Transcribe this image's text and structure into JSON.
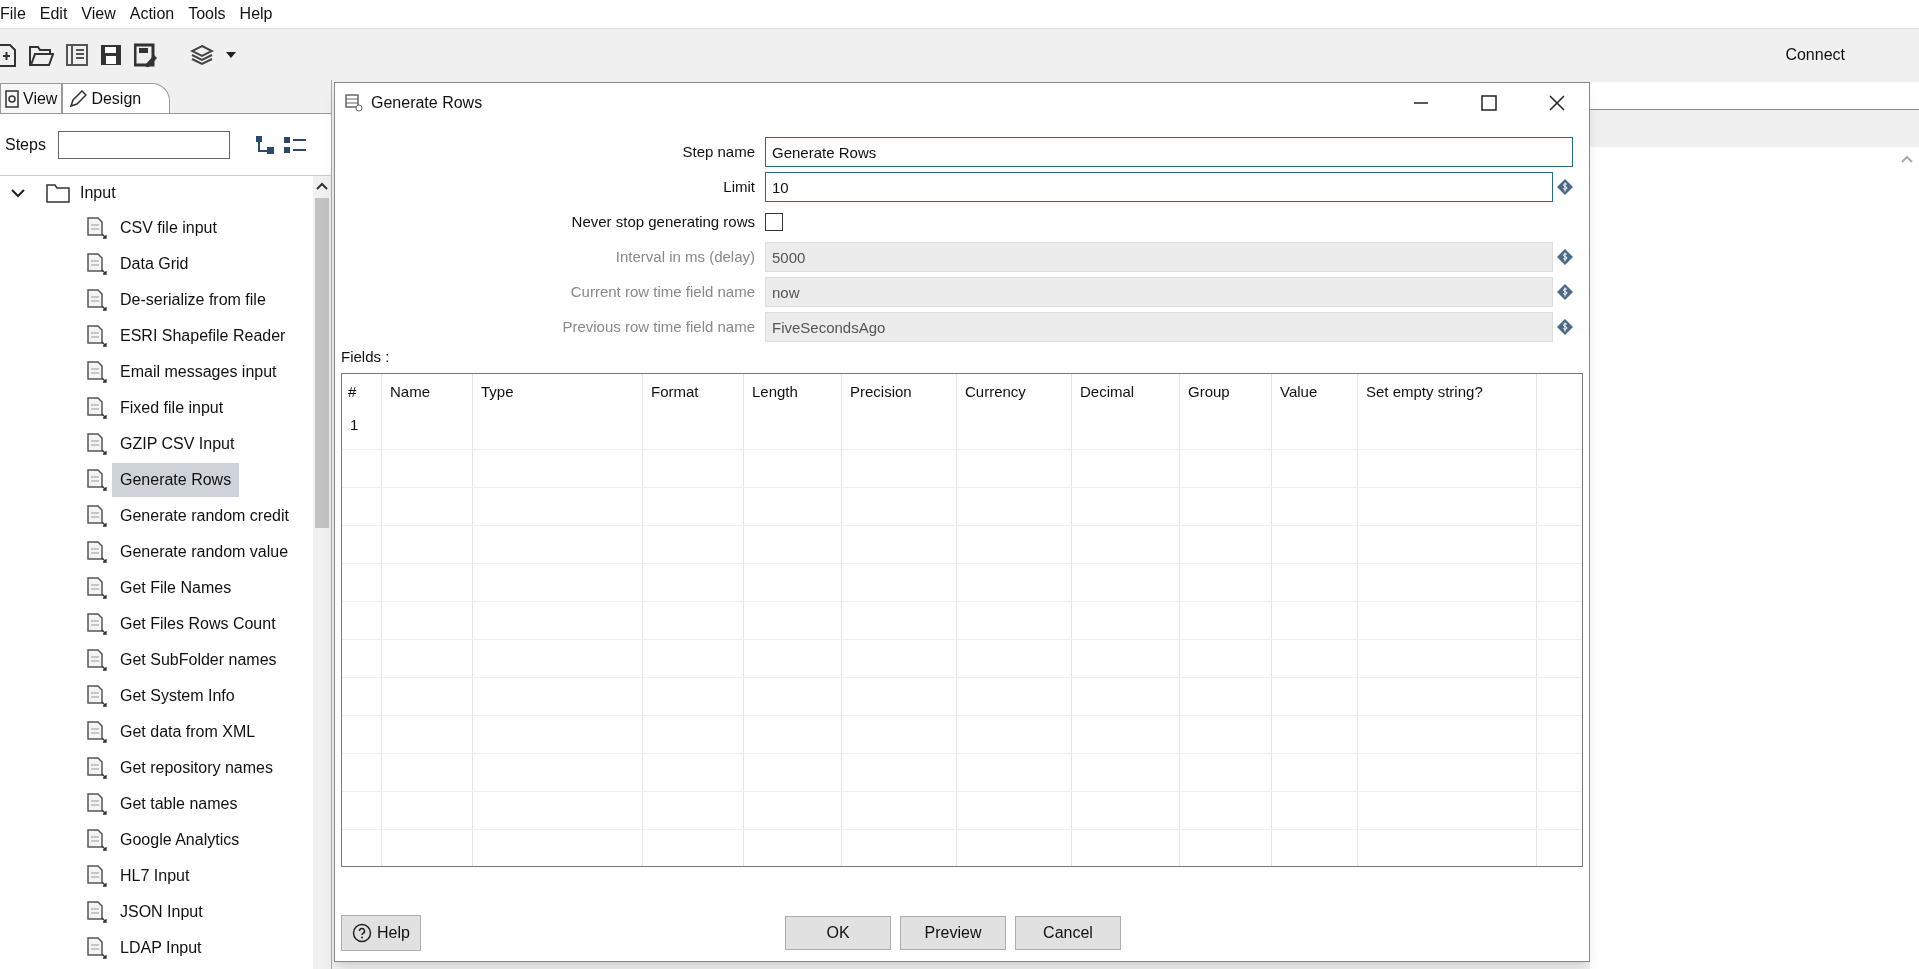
{
  "menu": [
    "File",
    "Edit",
    "View",
    "Action",
    "Tools",
    "Help"
  ],
  "toolbar": {
    "connect": "Connect"
  },
  "left_panel": {
    "tabs": [
      {
        "label": "View",
        "selected": false
      },
      {
        "label": "Design",
        "selected": true
      }
    ],
    "steps_label": "Steps",
    "tree": [
      {
        "label": "Input",
        "expanded": true,
        "children": [
          {
            "label": "CSV file input",
            "selected": false
          },
          {
            "label": "Data Grid",
            "selected": false
          },
          {
            "label": "De-serialize from file",
            "selected": false
          },
          {
            "label": "ESRI Shapefile Reader",
            "selected": false
          },
          {
            "label": "Email messages input",
            "selected": false
          },
          {
            "label": "Fixed file input",
            "selected": false
          },
          {
            "label": "GZIP CSV Input",
            "selected": false
          },
          {
            "label": "Generate Rows",
            "selected": true
          },
          {
            "label": "Generate random credit",
            "selected": false
          },
          {
            "label": "Generate random value",
            "selected": false
          },
          {
            "label": "Get File Names",
            "selected": false
          },
          {
            "label": "Get Files Rows Count",
            "selected": false
          },
          {
            "label": "Get SubFolder names",
            "selected": false
          },
          {
            "label": "Get System Info",
            "selected": false
          },
          {
            "label": "Get data from XML",
            "selected": false
          },
          {
            "label": "Get repository names",
            "selected": false
          },
          {
            "label": "Get table names",
            "selected": false
          },
          {
            "label": "Google Analytics",
            "selected": false
          },
          {
            "label": "HL7 Input",
            "selected": false
          },
          {
            "label": "JSON Input",
            "selected": false
          },
          {
            "label": "LDAP Input",
            "selected": false
          }
        ]
      }
    ]
  },
  "dialog": {
    "title": "Generate Rows",
    "form": [
      {
        "kind": "text",
        "label": "Step name",
        "value": "Generate Rows",
        "disabled": false,
        "variable": false
      },
      {
        "kind": "text",
        "label": "Limit",
        "value": "10",
        "disabled": false,
        "variable": true
      },
      {
        "kind": "checkbox",
        "label": "Never stop generating rows",
        "checked": false
      },
      {
        "kind": "text",
        "label": "Interval in ms (delay)",
        "value": "5000",
        "disabled": true,
        "variable": true
      },
      {
        "kind": "text",
        "label": "Current row time field name",
        "value": "now",
        "disabled": true,
        "variable": true
      },
      {
        "kind": "text",
        "label": "Previous row time field name",
        "value": "FiveSecondsAgo",
        "disabled": true,
        "variable": true
      }
    ],
    "fields_label": "Fields :",
    "table": {
      "columns": [
        "#",
        "Name",
        "Type",
        "Format",
        "Length",
        "Precision",
        "Currency",
        "Decimal",
        "Group",
        "Value",
        "Set empty string?"
      ],
      "rows": [
        [
          "1"
        ]
      ]
    },
    "help_button": "Help",
    "buttons": [
      "OK",
      "Preview",
      "Cancel"
    ]
  }
}
